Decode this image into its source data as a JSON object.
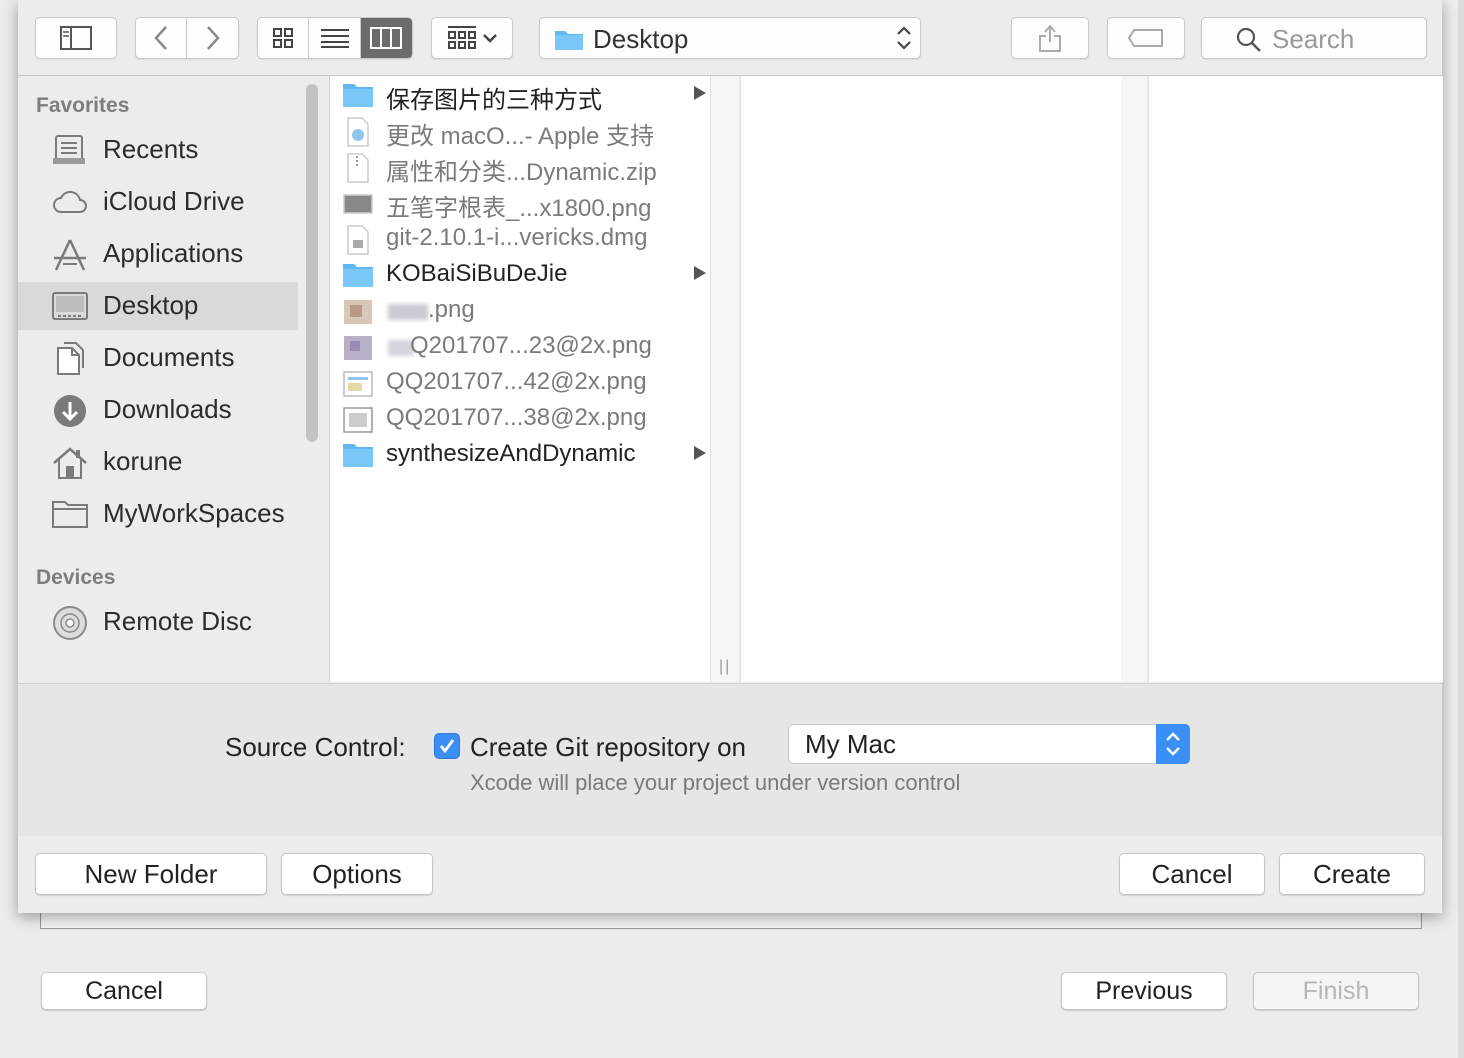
{
  "wizard": {
    "cancel_label": "Cancel",
    "previous_label": "Previous",
    "finish_label": "Finish"
  },
  "toolbar": {
    "location": "Desktop",
    "search_placeholder": "Search",
    "icons": [
      "sidebar-toggle-icon",
      "back-icon",
      "forward-icon",
      "icon-view-icon",
      "list-view-icon",
      "column-view-icon",
      "group-icon",
      "share-icon",
      "tag-icon",
      "search-icon"
    ]
  },
  "sidebar": {
    "favorites_heading": "Favorites",
    "favorites": [
      {
        "label": "Recents",
        "icon": "recents-icon"
      },
      {
        "label": "iCloud Drive",
        "icon": "cloud-icon"
      },
      {
        "label": "Applications",
        "icon": "applications-icon"
      },
      {
        "label": "Desktop",
        "icon": "desktop-icon"
      },
      {
        "label": "Documents",
        "icon": "documents-icon"
      },
      {
        "label": "Downloads",
        "icon": "downloads-icon"
      },
      {
        "label": "korune",
        "icon": "home-icon"
      },
      {
        "label": "MyWorkSpaces",
        "icon": "folder-icon"
      }
    ],
    "devices_heading": "Devices",
    "devices": [
      {
        "label": "Remote Disc",
        "icon": "disc-icon"
      }
    ]
  },
  "files": [
    {
      "name": "保存图片的三种方式",
      "kind": "folder"
    },
    {
      "name": "更改 macO...- Apple 支持",
      "kind": "doc"
    },
    {
      "name": "属性和分类...Dynamic.zip",
      "kind": "doc"
    },
    {
      "name": "五笔字根表_...x1800.png",
      "kind": "doc"
    },
    {
      "name": "git-2.10.1-i...vericks.dmg",
      "kind": "doc"
    },
    {
      "name": "KOBaiSiBuDeJie",
      "kind": "folder"
    },
    {
      "name": ".png",
      "kind": "doc"
    },
    {
      "name": "Q201707...23@2x.png",
      "kind": "doc"
    },
    {
      "name": "QQ201707...42@2x.png",
      "kind": "doc"
    },
    {
      "name": "QQ201707...38@2x.png",
      "kind": "doc"
    },
    {
      "name": "synthesizeAndDynamic",
      "kind": "folder"
    }
  ],
  "accessory": {
    "source_control_label": "Source Control:",
    "create_git_label": "Create Git repository on",
    "create_git_checked": true,
    "location_value": "My Mac",
    "hint": "Xcode will place your project under version control"
  },
  "footer": {
    "new_folder_label": "New Folder",
    "options_label": "Options",
    "cancel_label": "Cancel",
    "create_label": "Create"
  },
  "colors": {
    "accent": "#3a8ef5",
    "folder": "#5fb8f2"
  }
}
